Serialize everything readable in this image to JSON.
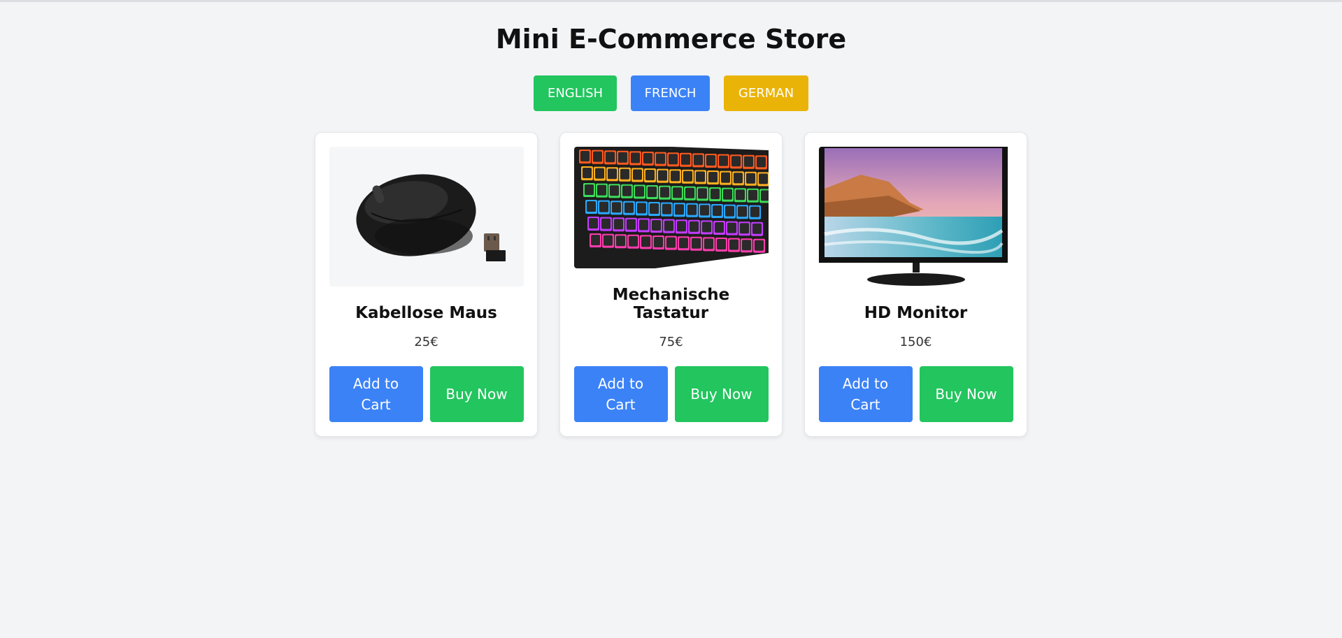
{
  "page": {
    "title": "Mini E-Commerce Store"
  },
  "languages": [
    {
      "label": "ENGLISH",
      "color": "#22c55e"
    },
    {
      "label": "FRENCH",
      "color": "#3b82f6"
    },
    {
      "label": "GERMAN",
      "color": "#eab308"
    }
  ],
  "products": [
    {
      "name": "Kabellose Maus",
      "price": "25€",
      "image": "wireless-mouse-image",
      "add_to_cart": "Add to Cart",
      "buy_now": "Buy Now"
    },
    {
      "name": "Mechanische Tastatur",
      "price": "75€",
      "image": "mechanical-keyboard-image",
      "add_to_cart": "Add to Cart",
      "buy_now": "Buy Now"
    },
    {
      "name": "HD Monitor",
      "price": "150€",
      "image": "hd-monitor-image",
      "add_to_cart": "Add to Cart",
      "buy_now": "Buy Now"
    }
  ],
  "colors": {
    "background": "#f3f4f6",
    "cart_button": "#3b82f6",
    "buy_button": "#22c55e"
  }
}
